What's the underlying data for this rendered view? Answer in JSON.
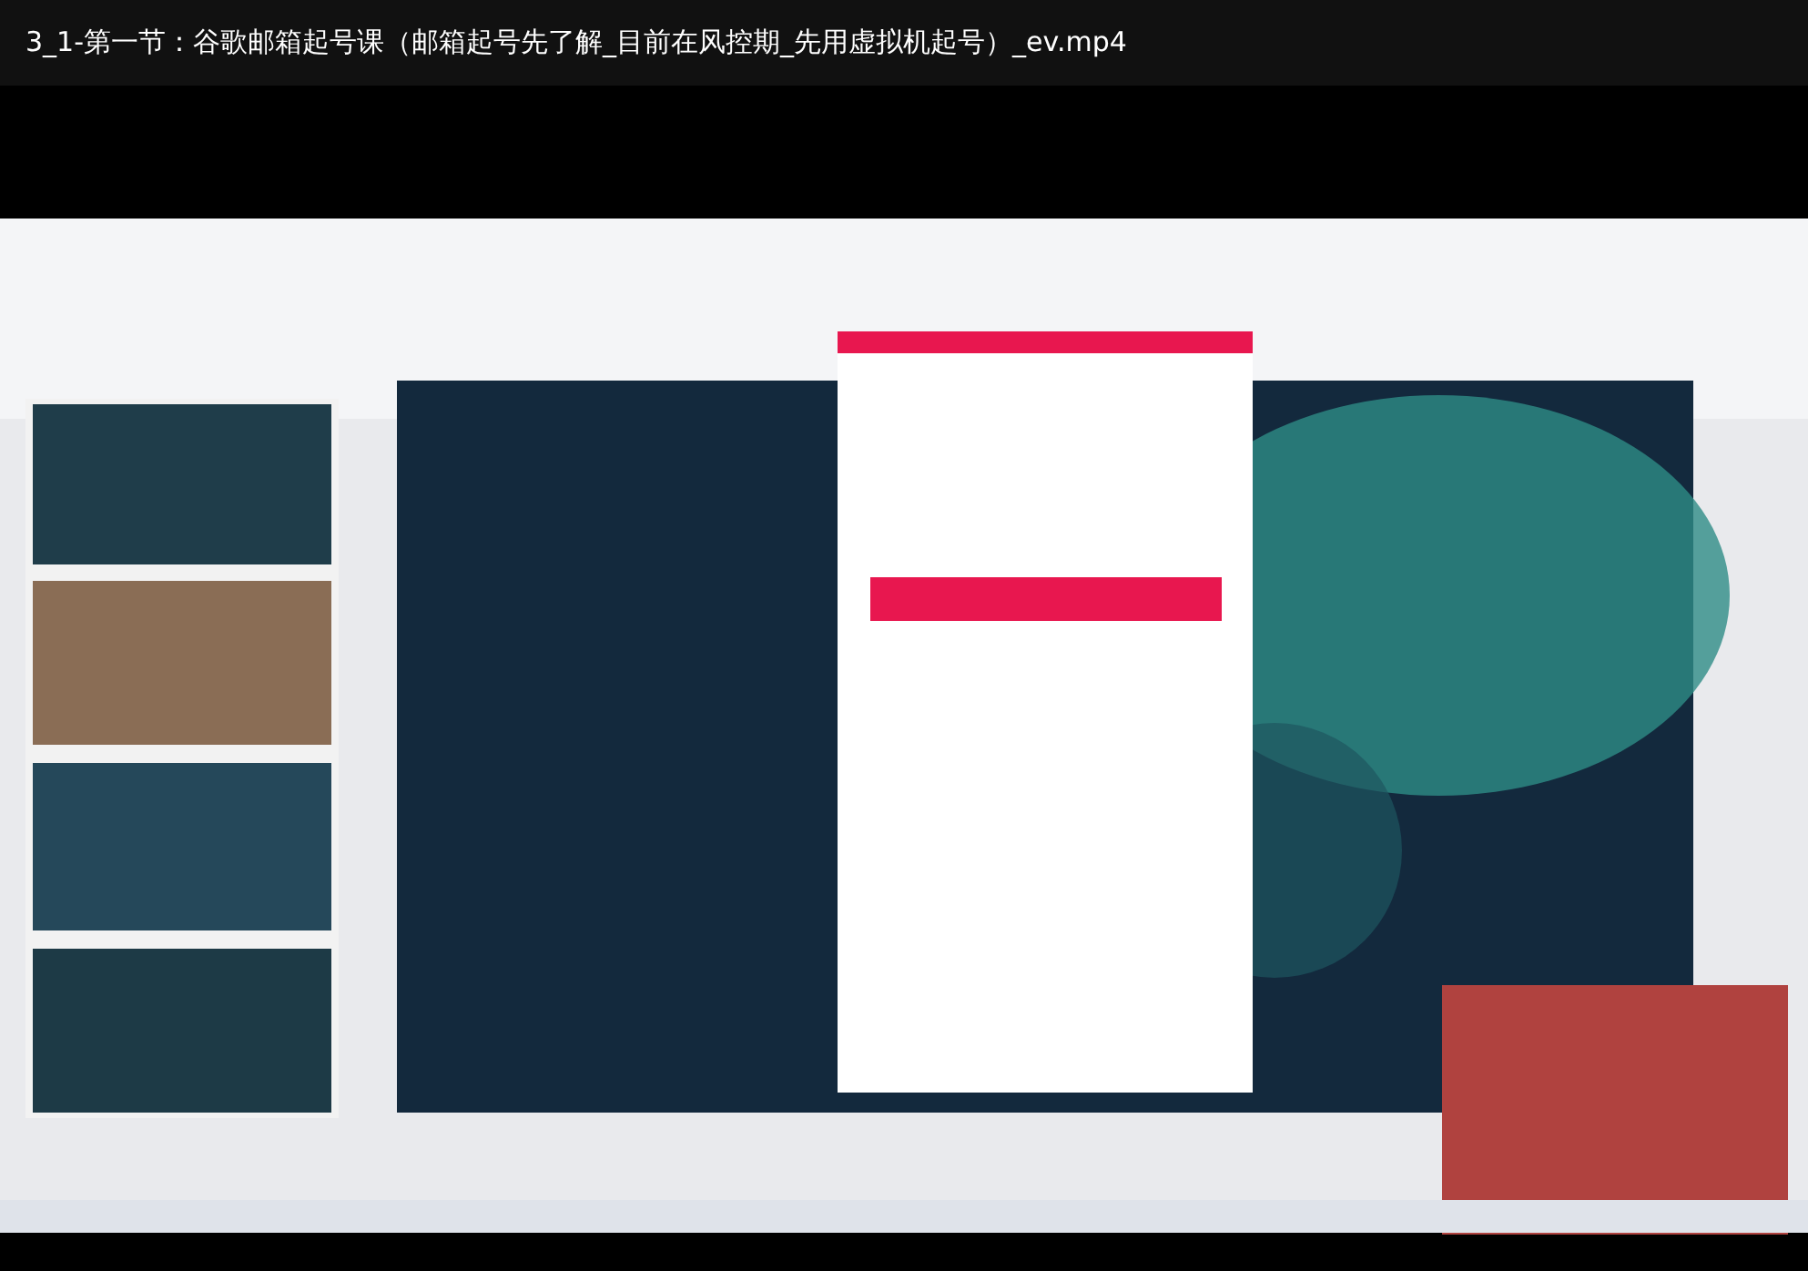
{
  "player": {
    "title": "3_1-第一节：谷歌邮箱起号课（邮箱起号先了解_目前在风控期_先用虚拟机起号）_ev.mp4"
  }
}
